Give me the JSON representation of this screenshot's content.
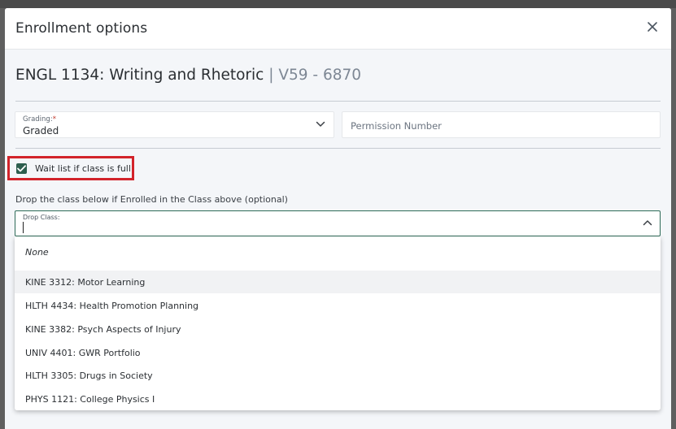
{
  "modal": {
    "title": "Enrollment options"
  },
  "course": {
    "code_name": "ENGL 1134: Writing and Rhetoric",
    "section": "| V59 - 6870"
  },
  "grading": {
    "label": "Grading:",
    "required_mark": "*",
    "value": "Graded"
  },
  "permission": {
    "placeholder": "Permission Number"
  },
  "waitlist": {
    "label": "Wait list if class is full",
    "checked": true
  },
  "drop": {
    "hint": "Drop the class below if Enrolled in the Class above (optional)",
    "label": "Drop Class:",
    "value": ""
  },
  "dropdown": {
    "options": [
      "None",
      "KINE 3312: Motor Learning",
      "HLTH 4434: Health Promotion Planning",
      "KINE 3382: Psych Aspects of Injury",
      "UNIV 4401: GWR Portfolio",
      "HLTH 3305: Drugs in Society",
      "PHYS 1121: College Physics I"
    ],
    "highlighted_index": 1
  },
  "colors": {
    "accent": "#2e5f4f",
    "highlight_box": "#d2232a"
  }
}
